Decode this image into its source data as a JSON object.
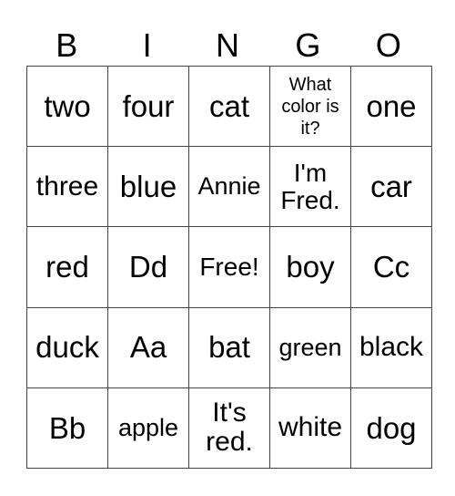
{
  "header": [
    "B",
    "I",
    "N",
    "G",
    "O"
  ],
  "rows": [
    [
      "two",
      "four",
      "cat",
      "What color is it?",
      "one"
    ],
    [
      "three",
      "blue",
      "Annie",
      "I'm Fred.",
      "car"
    ],
    [
      "red",
      "Dd",
      "Free!",
      "boy",
      "Cc"
    ],
    [
      "duck",
      "Aa",
      "bat",
      "green",
      "black"
    ],
    [
      "Bb",
      "apple",
      "It's red.",
      "white",
      "dog"
    ]
  ]
}
